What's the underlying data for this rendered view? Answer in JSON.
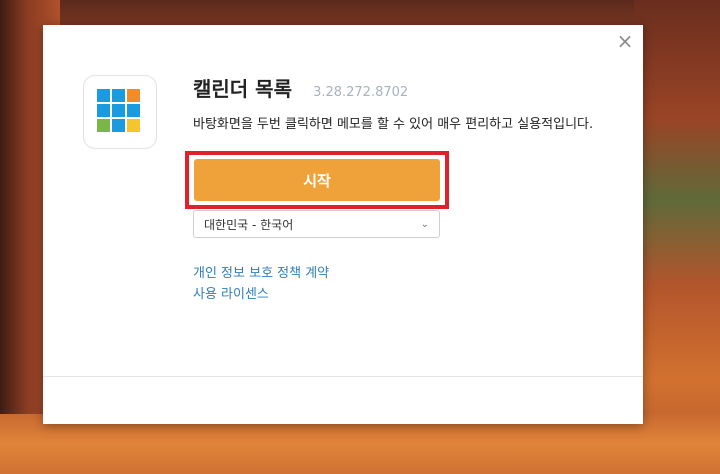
{
  "dialog": {
    "close_symbol": "×",
    "app_title": "캘린더 목록",
    "app_version": "3.28.272.8702",
    "description": "바탕화면을 두번 클릭하면 메모를 할 수 있어 매우 편리하고 실용적입니다.",
    "start_button": "시작",
    "language": {
      "selected": "대한민국 - 한국어",
      "chevron": "⌄"
    },
    "links": {
      "privacy": "개인 정보 보호 정책 계약",
      "license": "사용 라이센스"
    },
    "icon_colors": [
      "#1a9be0",
      "#1a9be0",
      "#f28c28",
      "#1a9be0",
      "#1a9be0",
      "#1a9be0",
      "#7ab648",
      "#1a9be0",
      "#f5c52e"
    ]
  },
  "colors": {
    "start_button": "#f0a23a",
    "highlight_border": "#e0202a",
    "link": "#2f7fb8",
    "version": "#a9b2bd"
  }
}
